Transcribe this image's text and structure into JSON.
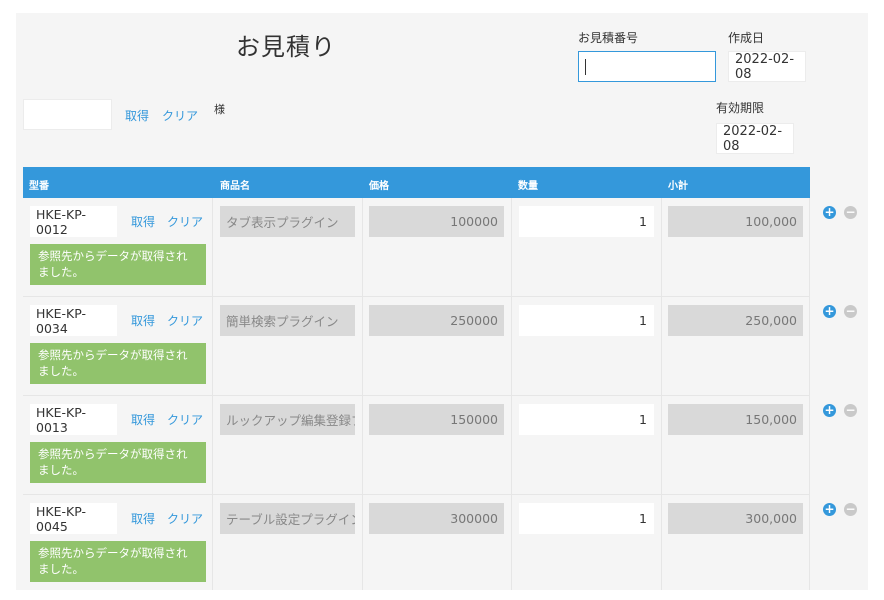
{
  "header": {
    "title": "お見積り",
    "quote_number_label": "お見積番号",
    "quote_number_value": "",
    "created_label": "作成日",
    "created_value": "2022-02-08",
    "valid_until_label": "有効期限",
    "valid_until_value": "2022-02-08"
  },
  "customer": {
    "value": "",
    "get_label": "取得",
    "clear_label": "クリア",
    "honorific": "様"
  },
  "table": {
    "columns": [
      "型番",
      "商品名",
      "価格",
      "数量",
      "小計"
    ],
    "rows": [
      {
        "code": "HKE-KP-0012",
        "get": "取得",
        "clear": "クリア",
        "message": "参照先からデータが取得されました。",
        "name": "タブ表示プラグイン",
        "price": "100000",
        "qty": "1",
        "subtotal": "100,000"
      },
      {
        "code": "HKE-KP-0034",
        "get": "取得",
        "clear": "クリア",
        "message": "参照先からデータが取得されました。",
        "name": "簡単検索プラグイン",
        "price": "250000",
        "qty": "1",
        "subtotal": "250,000"
      },
      {
        "code": "HKE-KP-0013",
        "get": "取得",
        "clear": "クリア",
        "message": "参照先からデータが取得されました。",
        "name": "ルックアップ編集登録プ",
        "price": "150000",
        "qty": "1",
        "subtotal": "150,000"
      },
      {
        "code": "HKE-KP-0045",
        "get": "取得",
        "clear": "クリア",
        "message": "参照先からデータが取得されました。",
        "name": "テーブル設定プラグイン",
        "price": "300000",
        "qty": "1",
        "subtotal": "300,000"
      }
    ],
    "add_symbol": "+",
    "remove_symbol": "−"
  },
  "colors": {
    "accent": "#3498db",
    "success": "#91c36c",
    "readonly_bg": "#d9d9d9",
    "panel_bg": "#f5f5f5"
  }
}
